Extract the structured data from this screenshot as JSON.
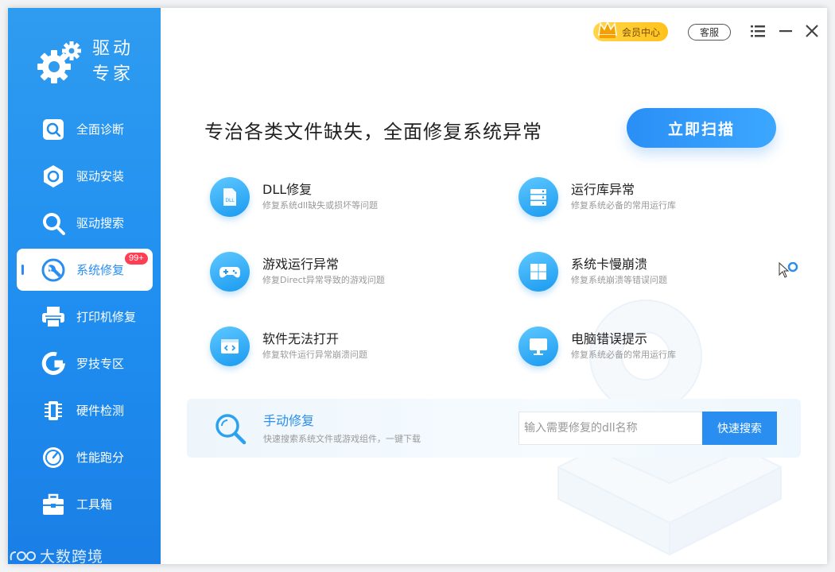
{
  "app": {
    "name_line1": "驱动",
    "name_line2": "专家"
  },
  "sidebar": {
    "items": [
      {
        "label": "全面诊断",
        "icon": "diagnose-icon"
      },
      {
        "label": "驱动安装",
        "icon": "driver-install-icon"
      },
      {
        "label": "驱动搜索",
        "icon": "driver-search-icon"
      },
      {
        "label": "系统修复",
        "icon": "wrench-icon",
        "badge": "99+",
        "active": true
      },
      {
        "label": "打印机修复",
        "icon": "printer-icon"
      },
      {
        "label": "罗技专区",
        "icon": "logitech-icon"
      },
      {
        "label": "硬件检测",
        "icon": "chip-icon"
      },
      {
        "label": "性能跑分",
        "icon": "gauge-icon"
      },
      {
        "label": "工具箱",
        "icon": "toolbox-icon"
      }
    ]
  },
  "watermark": "大数跨境",
  "topbar": {
    "vip_label": "会员中心",
    "service_label": "客服"
  },
  "main": {
    "headline": "专治各类文件缺失，全面修复系统异常",
    "scan_button": "立即扫描",
    "features": [
      {
        "title": "DLL修复",
        "subtitle": "修复系统dll缺失或损坏等问题",
        "icon": "dll-icon"
      },
      {
        "title": "运行库异常",
        "subtitle": "修复系统必备的常用运行库",
        "icon": "runtime-library-icon"
      },
      {
        "title": "游戏运行异常",
        "subtitle": "修复Direct异常导致的游戏问题",
        "icon": "gamepad-icon"
      },
      {
        "title": "系统卡慢崩溃",
        "subtitle": "修复系统崩溃等错误问题",
        "icon": "windows-icon"
      },
      {
        "title": "软件无法打开",
        "subtitle": "修复软件运行异常崩溃问题",
        "icon": "code-window-icon"
      },
      {
        "title": "电脑错误提示",
        "subtitle": "修复系统必备的常用运行库",
        "icon": "monitor-icon"
      }
    ],
    "manual": {
      "title": "手动修复",
      "subtitle": "快速搜索系统文件或游戏组件，一键下载",
      "placeholder": "输入需要修复的dll名称",
      "button": "快速搜索"
    }
  },
  "colors": {
    "accent": "#2a8ef0",
    "sidebar": "#1f8ef0",
    "badge": "#ff3d55",
    "vip": "#ffc21a"
  }
}
